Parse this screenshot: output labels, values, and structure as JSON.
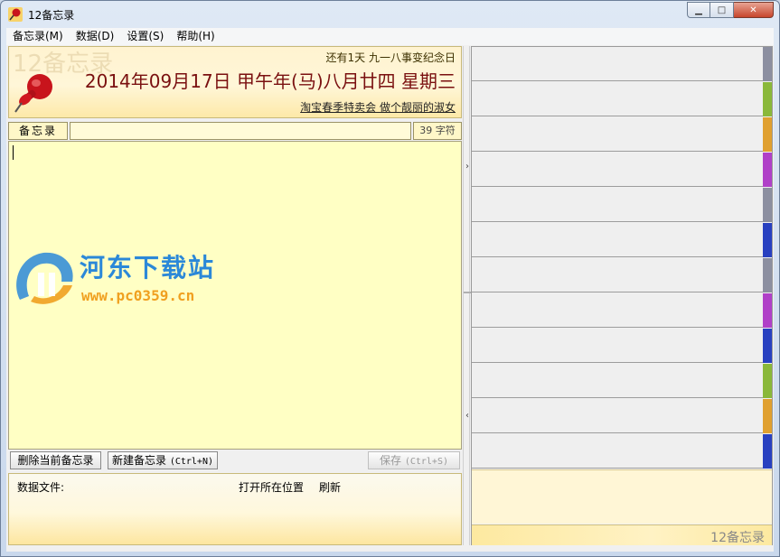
{
  "window": {
    "title": "12备忘录"
  },
  "menu": [
    "备忘录(M)",
    "数据(D)",
    "设置(S)",
    "帮助(H)"
  ],
  "header": {
    "watermark_title": "12备忘录",
    "countdown": "还有1天  九一八事变纪念日",
    "date": "2014年09月17日 甲午年(马)八月廿四 星期三",
    "ad_link": "淘宝春季特卖会 做个靓丽的淑女"
  },
  "editor": {
    "field_label": "备忘录",
    "title_value": "",
    "char_count": "39 字符",
    "content": ""
  },
  "watermark": {
    "name": "河东下载站",
    "url": "www.pc0359.cn"
  },
  "buttons": {
    "delete": "删除当前备忘录",
    "new": "新建备忘录",
    "new_shortcut": "(Ctrl+N)",
    "save": "保存",
    "save_shortcut": "(Ctrl+S)"
  },
  "filebar": {
    "label": "数据文件:",
    "open_location": "打开所在位置",
    "refresh": "刷新"
  },
  "splitter": {
    "collapse_arrow": "›",
    "expand_arrow": "‹"
  },
  "right_panel": {
    "slot_tab_colors": [
      "#8c8fa0",
      "#8ab83a",
      "#e0a030",
      "#b040c8",
      "#8c8fa0",
      "#2840c0",
      "#8c8fa0",
      "#b040c8",
      "#2840c0",
      "#8ab83a",
      "#e0a030",
      "#2840c0"
    ],
    "brand": "12备忘录"
  },
  "colors": {
    "editor_bg": "#ffffc4",
    "date_color": "#7a1010",
    "watermark_blue": "#2b88d8",
    "watermark_orange": "#f0a020"
  }
}
